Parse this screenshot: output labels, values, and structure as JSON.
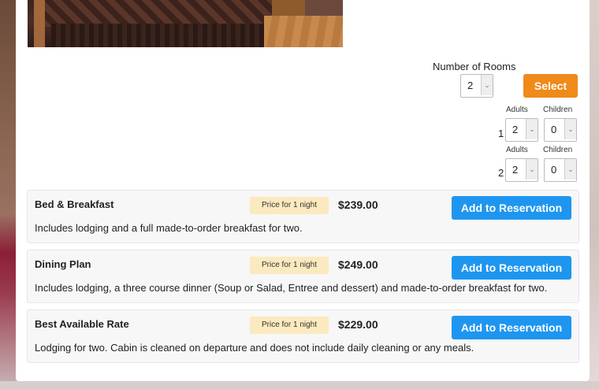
{
  "rooms": {
    "label": "Number of Rooms",
    "count": "2",
    "select_button": "Select"
  },
  "occupancy": [
    {
      "room": "1",
      "adults_label": "Adults",
      "children_label": "Children",
      "adults": "2",
      "children": "0"
    },
    {
      "room": "2",
      "adults_label": "Adults",
      "children_label": "Children",
      "adults": "2",
      "children": "0"
    }
  ],
  "rates": [
    {
      "name": "Bed & Breakfast",
      "badge": "Price for 1 night",
      "price": "$239.00",
      "button": "Add to Reservation",
      "description": "Includes lodging and a full made-to-order breakfast for two."
    },
    {
      "name": "Dining Plan",
      "badge": "Price for 1 night",
      "price": "$249.00",
      "button": "Add to Reservation",
      "description": "Includes lodging, a three course dinner (Soup or Salad, Entree and dessert) and made-to-order breakfast for two."
    },
    {
      "name": "Best Available Rate",
      "badge": "Price for 1 night",
      "price": "$229.00",
      "button": "Add to Reservation",
      "description": "Lodging for two. Cabin is cleaned on departure and does not include daily cleaning or any meals."
    }
  ],
  "colors": {
    "select_button": "#ef8a1b",
    "add_button": "#1e96f0",
    "badge": "#fbeabf"
  },
  "icons": {
    "dropdown": "chevron-down-icon"
  }
}
